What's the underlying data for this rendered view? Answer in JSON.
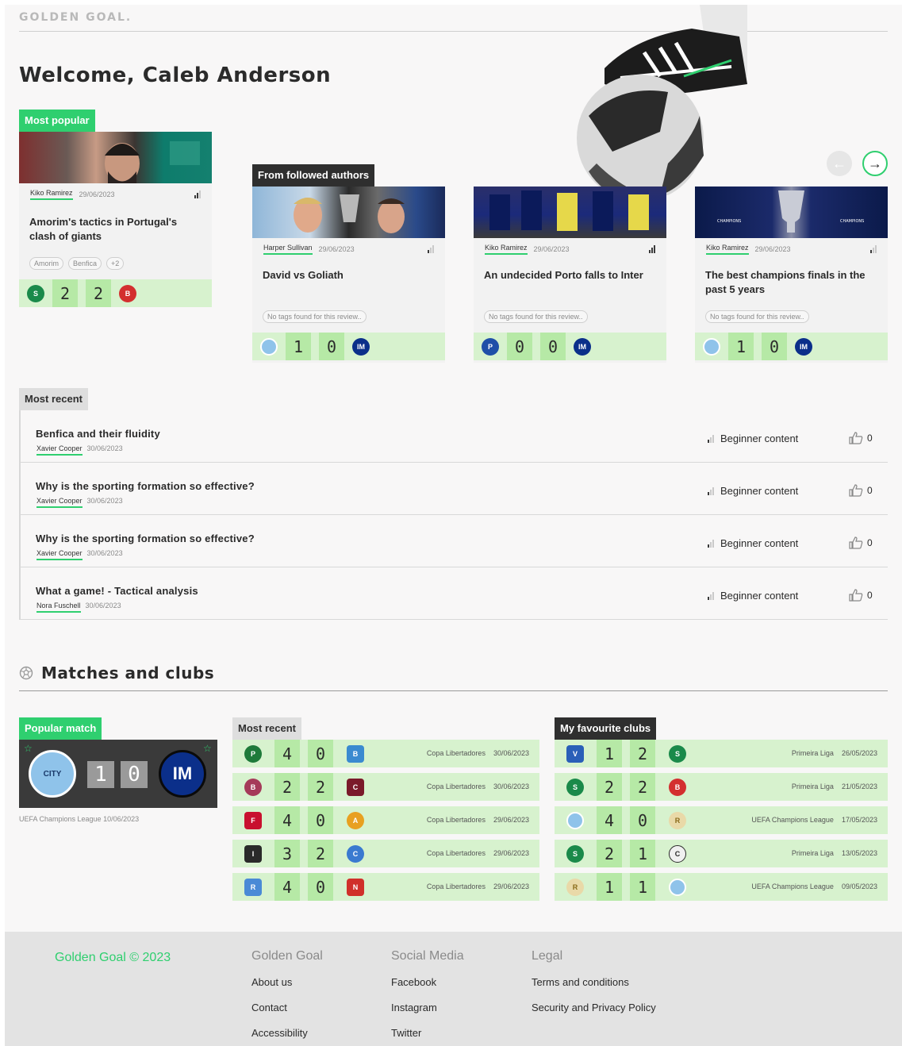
{
  "brand": {
    "logo": "GOLDEN GOAL."
  },
  "welcome": "Welcome, Caleb Anderson",
  "featured": [
    {
      "tag": "Most popular",
      "author": "Kiko Ramirez",
      "date": "29/06/2023",
      "title": "Amorim's tactics in Portugal's clash of giants",
      "tags": [
        "Amorim",
        "Benfica",
        "+2"
      ],
      "home_score": "2",
      "away_score": "2",
      "home_club": "Sporting",
      "away_club": "Benfica"
    },
    {
      "tag": "From followed authors",
      "author": "Harper Sullivan",
      "date": "29/06/2023",
      "title": "David vs Goliath",
      "no_tags": "No tags found for this review..",
      "home_score": "1",
      "away_score": "0",
      "home_club": "Man City",
      "away_club": "Inter"
    },
    {
      "author": "Kiko Ramirez",
      "date": "29/06/2023",
      "title": "An undecided Porto falls to Inter",
      "no_tags": "No tags found for this review..",
      "home_score": "0",
      "away_score": "0",
      "home_club": "Porto",
      "away_club": "Inter"
    },
    {
      "author": "Kiko Ramirez",
      "date": "29/06/2023",
      "title": "The best champions finals in the past 5 years",
      "no_tags": "No tags found for this review..",
      "home_score": "1",
      "away_score": "0",
      "home_club": "Man City",
      "away_club": "Inter"
    }
  ],
  "most_recent": {
    "label": "Most recent",
    "items": [
      {
        "title": "Benfica and their fluidity",
        "author": "Xavier Cooper",
        "date": "30/06/2023",
        "level": "Beginner content",
        "likes": "0"
      },
      {
        "title": "Why is the sporting formation so effective?",
        "author": "Xavier Cooper",
        "date": "30/06/2023",
        "level": "Beginner content",
        "likes": "0"
      },
      {
        "title": "Why is the sporting formation so effective?",
        "author": "Xavier Cooper",
        "date": "30/06/2023",
        "level": "Beginner content",
        "likes": "0"
      },
      {
        "title": "What a game! - Tactical analysis",
        "author": "Nora Fuschell",
        "date": "30/06/2023",
        "level": "Beginner content",
        "likes": "0"
      }
    ]
  },
  "matches": {
    "title": "Matches and clubs",
    "popular": {
      "label": "Popular match",
      "home_score": "1",
      "away_score": "0",
      "home_club": "CITY",
      "away_club": "IM",
      "caption": "UEFA Champions League  10/06/2023"
    },
    "recent": {
      "label": "Most recent",
      "rows": [
        {
          "home": "4",
          "away": "0",
          "competition": "Copa Libertadores",
          "date": "30/06/2023"
        },
        {
          "home": "2",
          "away": "2",
          "competition": "Copa Libertadores",
          "date": "30/06/2023"
        },
        {
          "home": "4",
          "away": "0",
          "competition": "Copa Libertadores",
          "date": "29/06/2023"
        },
        {
          "home": "3",
          "away": "2",
          "competition": "Copa Libertadores",
          "date": "29/06/2023"
        },
        {
          "home": "4",
          "away": "0",
          "competition": "Copa Libertadores",
          "date": "29/06/2023"
        }
      ]
    },
    "favourites": {
      "label": "My favourite clubs",
      "rows": [
        {
          "home": "1",
          "away": "2",
          "competition": "Primeira Liga",
          "date": "26/05/2023"
        },
        {
          "home": "2",
          "away": "2",
          "competition": "Primeira Liga",
          "date": "21/05/2023"
        },
        {
          "home": "4",
          "away": "0",
          "competition": "UEFA Champions League",
          "date": "17/05/2023"
        },
        {
          "home": "2",
          "away": "1",
          "competition": "Primeira Liga",
          "date": "13/05/2023"
        },
        {
          "home": "1",
          "away": "1",
          "competition": "UEFA Champions League",
          "date": "09/05/2023"
        }
      ]
    }
  },
  "footer": {
    "brand": "Golden Goal © 2023",
    "columns": [
      {
        "heading": "Golden Goal",
        "links": [
          "About us",
          "Contact",
          "Accessibility"
        ]
      },
      {
        "heading": "Social Media",
        "links": [
          "Facebook",
          "Instagram",
          "Twitter"
        ]
      },
      {
        "heading": "Legal",
        "links": [
          "Terms and conditions",
          "Security and Privacy Policy"
        ]
      }
    ]
  },
  "colors": {
    "accent": "#2fcf6f",
    "score_bg": "#d7f2ce",
    "score_cell": "#b6e9a6"
  }
}
